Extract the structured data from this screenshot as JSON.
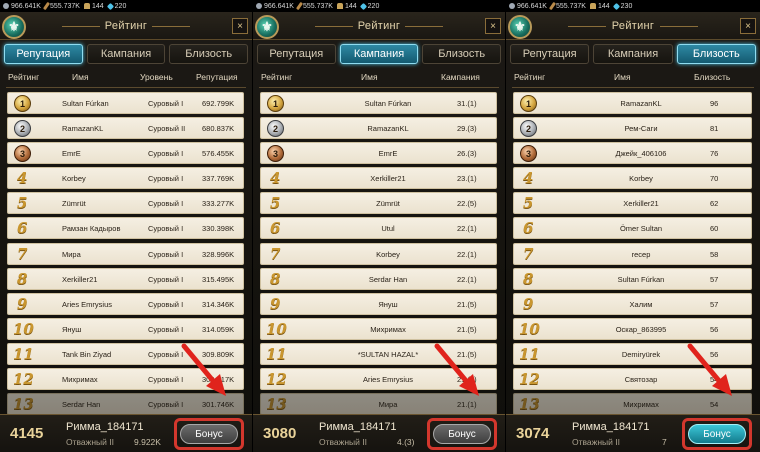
{
  "resources": {
    "silver": "966.641K",
    "wood": "555.737K",
    "warriors": "144",
    "gems": "220",
    "gems_alt": "230"
  },
  "header": {
    "title": "Рейтинг",
    "close": "×"
  },
  "tabs": [
    "Репутация",
    "Кампания",
    "Близость"
  ],
  "panels": [
    {
      "active_tab": 0,
      "columns": [
        "Рейтинг",
        "Имя",
        "Уровень",
        "Репутация"
      ],
      "rows": [
        {
          "rank": "1",
          "name": "Sultan Fúrkan",
          "level": "Суровый I",
          "value": "692.799K"
        },
        {
          "rank": "2",
          "name": "RamazanKL",
          "level": "Суровый II",
          "value": "680.837K"
        },
        {
          "rank": "3",
          "name": "EmrE",
          "level": "Суровый I",
          "value": "576.455K"
        },
        {
          "rank": "4",
          "name": "Korbey",
          "level": "Суровый I",
          "value": "337.769K"
        },
        {
          "rank": "5",
          "name": "Zümrüt",
          "level": "Суровый I",
          "value": "333.277K"
        },
        {
          "rank": "6",
          "name": "Рамзан Кадыров",
          "level": "Суровый I",
          "value": "330.398K"
        },
        {
          "rank": "7",
          "name": "Мира",
          "level": "Суровый I",
          "value": "328.996K"
        },
        {
          "rank": "8",
          "name": "Xerkiller21",
          "level": "Суровый I",
          "value": "315.495K"
        },
        {
          "rank": "9",
          "name": "Aries Emrysius",
          "level": "Суровый I",
          "value": "314.346K"
        },
        {
          "rank": "10",
          "name": "Януш",
          "level": "Суровый I",
          "value": "314.059K"
        },
        {
          "rank": "11",
          "name": "Tank Bin Ziyad",
          "level": "Суровый I",
          "value": "309.809K"
        },
        {
          "rank": "12",
          "name": "Михримах",
          "level": "Суровый I",
          "value": "302.417K"
        },
        {
          "rank": "13",
          "name": "Serdar Han",
          "level": "Суровый I",
          "value": "301.746K"
        }
      ],
      "me": {
        "rank": "4145",
        "name": "Римма_184171",
        "title": "Отважный II",
        "score": "9.922K"
      },
      "bonus": "Бонус"
    },
    {
      "active_tab": 1,
      "columns": [
        "Рейтинг",
        "Имя",
        "Кампания"
      ],
      "rows": [
        {
          "rank": "1",
          "name": "Sultan Fúrkan",
          "value": "31.(1)"
        },
        {
          "rank": "2",
          "name": "RamazanKL",
          "value": "29.(3)"
        },
        {
          "rank": "3",
          "name": "EmrE",
          "value": "26.(3)"
        },
        {
          "rank": "4",
          "name": "Xerkiller21",
          "value": "23.(1)"
        },
        {
          "rank": "5",
          "name": "Zümrüt",
          "value": "22.(5)"
        },
        {
          "rank": "6",
          "name": "Utul",
          "value": "22.(1)"
        },
        {
          "rank": "7",
          "name": "Korbey",
          "value": "22.(1)"
        },
        {
          "rank": "8",
          "name": "Serdar Han",
          "value": "22.(1)"
        },
        {
          "rank": "9",
          "name": "Януш",
          "value": "21.(5)"
        },
        {
          "rank": "10",
          "name": "Михримах",
          "value": "21.(5)"
        },
        {
          "rank": "11",
          "name": "*SULTAN HAZAL*",
          "value": "21.(5)"
        },
        {
          "rank": "12",
          "name": "Aries Emrysius",
          "value": "21.(1)"
        },
        {
          "rank": "13",
          "name": "Мира",
          "value": "21.(1)"
        }
      ],
      "me": {
        "rank": "3080",
        "name": "Римма_184171",
        "title": "Отважный II",
        "score": "4.(3)"
      },
      "bonus": "Бонус"
    },
    {
      "active_tab": 2,
      "columns": [
        "Рейтинг",
        "Имя",
        "Близость"
      ],
      "rows": [
        {
          "rank": "1",
          "name": "RamazanKL",
          "value": "96"
        },
        {
          "rank": "2",
          "name": "Рем-Саги",
          "value": "81"
        },
        {
          "rank": "3",
          "name": "Джейк_406106",
          "value": "76"
        },
        {
          "rank": "4",
          "name": "Korbey",
          "value": "70"
        },
        {
          "rank": "5",
          "name": "Xerkiller21",
          "value": "62"
        },
        {
          "rank": "6",
          "name": "Ömer Sultan",
          "value": "60"
        },
        {
          "rank": "7",
          "name": "recep",
          "value": "58"
        },
        {
          "rank": "8",
          "name": "Sultan Fúrkan",
          "value": "57"
        },
        {
          "rank": "9",
          "name": "Халим",
          "value": "57"
        },
        {
          "rank": "10",
          "name": "Оскар_863995",
          "value": "56"
        },
        {
          "rank": "11",
          "name": "Demiryürek",
          "value": "56"
        },
        {
          "rank": "12",
          "name": "Святозар",
          "value": "54"
        },
        {
          "rank": "13",
          "name": "Михримах",
          "value": "54"
        }
      ],
      "me": {
        "rank": "3074",
        "name": "Римма_184171",
        "title": "Отважный II",
        "score": "7"
      },
      "bonus": "Бонус"
    }
  ],
  "colors": {
    "accent": "#2e89a4",
    "gold": "#c9962f",
    "highlight_red": "#d3372d",
    "row_bg": "#f1eadb"
  }
}
